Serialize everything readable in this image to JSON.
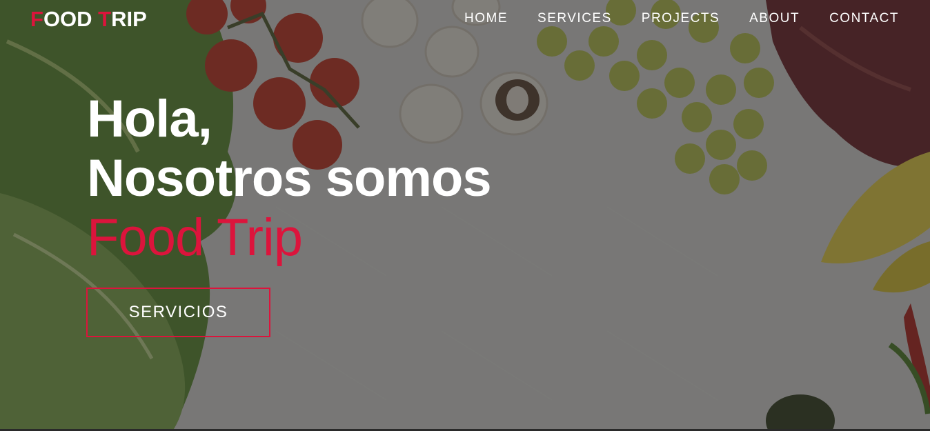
{
  "brand": {
    "logo_first_initial": "F",
    "logo_first_rest": "OOD ",
    "logo_second_initial": "T",
    "logo_second_rest": "RIP"
  },
  "nav": {
    "items": [
      {
        "label": "HOME"
      },
      {
        "label": "SERVICES"
      },
      {
        "label": "PROJECTS"
      },
      {
        "label": "ABOUT"
      },
      {
        "label": "CONTACT"
      }
    ]
  },
  "hero": {
    "line1": "Hola,",
    "line2": "Nosotros somos",
    "line3": "Food Trip",
    "cta_label": "SERVICIOS"
  },
  "colors": {
    "accent": "#dc143c",
    "text": "#ffffff",
    "overlay": "#282828"
  }
}
